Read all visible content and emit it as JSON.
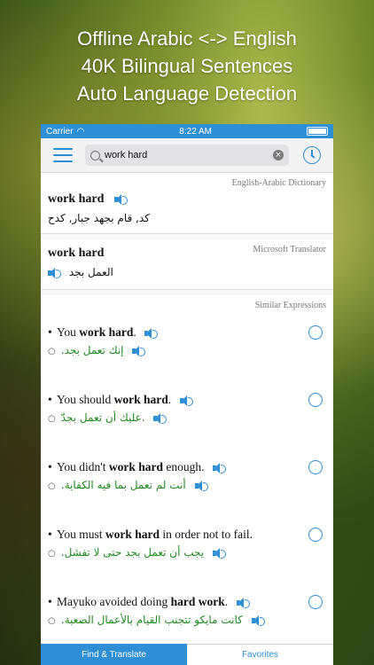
{
  "promo": [
    "Offline Arabic <-> English",
    "40K Bilingual Sentences",
    "Auto Language Detection"
  ],
  "status": {
    "carrier": "Carrier",
    "time": "8:22 AM"
  },
  "search": {
    "value": "work hard"
  },
  "dictionary": {
    "source": "English-Arabic Dictionary",
    "term": "work hard",
    "translation": "كد, قام بجهد جبار, كدح"
  },
  "translator": {
    "source": "Microsoft Translator",
    "term": "work hard",
    "translation": "العمل بجد"
  },
  "similar": {
    "source": "Similar Expressions",
    "items": [
      {
        "pre": "You ",
        "bold": "work hard",
        "post": ".",
        "ar": ".إنك تعمل بجد"
      },
      {
        "pre": "You should ",
        "bold": "work hard",
        "post": ".",
        "ar": "عليك أن تعمل بجدّ."
      },
      {
        "pre": "You didn't ",
        "bold": "work hard",
        "post": " enough.",
        "ar": ".أنت لم تعمل بما فيه الكفاية"
      },
      {
        "pre": "You must ",
        "bold": "work hard",
        "post": " in order not to fail.",
        "ar": ".يجب أن تعمل بجد حتى لا تفشل"
      },
      {
        "pre": "Mayuko avoided doing ",
        "bold": "hard work",
        "post": ".",
        "ar": ".كانت مايكو تتجنب القيام بالأعمال الصعبة"
      }
    ]
  },
  "tabs": {
    "find": "Find & Translate",
    "favorites": "Favorites"
  },
  "colors": {
    "accent": "#2f8fd6",
    "arabic_green": "#1d8a1d"
  }
}
